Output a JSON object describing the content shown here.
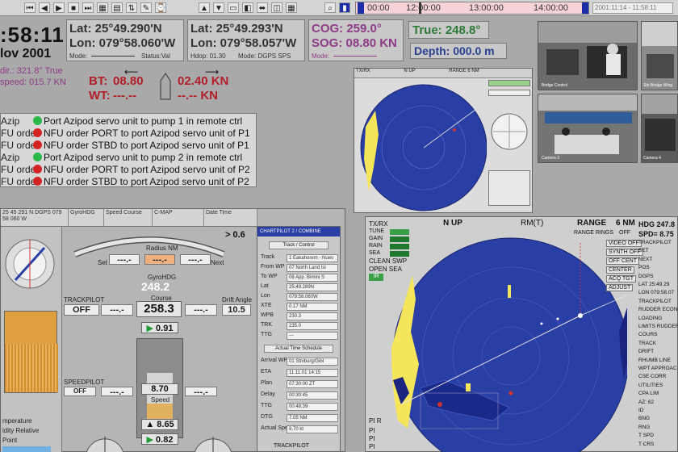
{
  "toolbar": {
    "buttons": [
      "⏮",
      "◀",
      "▶",
      "■",
      "⏭",
      "▦",
      "▤",
      "⇅",
      "✎",
      "⌚"
    ],
    "nav_buttons": [
      "▲",
      "▼",
      "▭",
      "◧",
      "⬌",
      "◫",
      "▦"
    ],
    "zoom_icon": "⌕",
    "times": [
      "00:00",
      "12:00:00",
      "13:00:00",
      "14:00:00"
    ],
    "stamp": "2001:11:14 - 11:58:11"
  },
  "clock": {
    "time": ":58:11",
    "date": "lov 2001"
  },
  "position_1": {
    "lat": "Lat:   25°49.290'N",
    "lon": "Lon: 079°58.060'W",
    "mode_label": "Mode:",
    "status_label": "Status:Val"
  },
  "position_2": {
    "lat": "Lat:   25°49.293'N",
    "lon": "Lon: 079°58.057'W",
    "hdop": "Hdop: 01.30",
    "mode": "Mode: DGPS SPS"
  },
  "cog": {
    "cog": "COG: 259.0°",
    "sog": "SOG: 08.80 KN",
    "mode_label": "Mode:"
  },
  "true_heading": "True:   248.8°",
  "depth": "Depth: 000.0 m",
  "speed_strip": {
    "dir": "dir.: 321.8° True",
    "speed": "speed: 015.7 KN"
  },
  "bt_wt": {
    "bt_label": "BT:",
    "bt_fwd": "08.80",
    "bt_aft": "02.40 KN",
    "wt_label": "WT:",
    "wt_fwd": "---.--",
    "wt_aft": "--.-- KN"
  },
  "alarms": [
    {
      "tag": "Azip",
      "color": "green",
      "text": "Port Azipod servo unit to pump 1 in remote ctrl"
    },
    {
      "tag": "FU orde",
      "color": "red",
      "text": "NFU order PORT to port Azipod servo unit of P1"
    },
    {
      "tag": "FU orde",
      "color": "red",
      "text": "NFU order STBD to port Azipod servo unit of P1"
    },
    {
      "tag": "Azip",
      "color": "green",
      "text": "Port Azipod servo unit to pump 2 in remote ctrl"
    },
    {
      "tag": "FU orde",
      "color": "red",
      "text": "NFU order PORT to port Azipod servo unit of P2"
    },
    {
      "tag": "FU orde",
      "color": "red",
      "text": "NFU order STBD to port Azipod servo unit of P2"
    }
  ],
  "left_panel": {
    "header_cells": [
      "25 45 291 N DGPS\n 079 58 060 W",
      "GyroHDG",
      "Speed\nCourse",
      "C-MAP",
      "Date\nTime",
      "CHARTPILOT 2 / COMBINE"
    ],
    "radius_label": "Radius NM",
    "gt": "> 0.6",
    "set_label": "Set",
    "next_label": "Next",
    "gyrohdg_label": "GyroHDG",
    "gyrohdg": "248.2",
    "course_label": "Course",
    "course": "258.3",
    "trackpilot_label": "TRACKPILOT",
    "trackpilot_value": "OFF",
    "drift_label": "Drift Angle",
    "drift": "10.5",
    "rot_value": "0.91",
    "speedpilot_label": "SPEEDPILOT",
    "speedpilot_value": "OFF",
    "speed_label": "Speed",
    "speed_set": "8.70",
    "speed_actual": "8.65",
    "speed_lower": "0.82",
    "dashes": "---.-",
    "left_labels": [
      "mperature",
      "idity Relative",
      "Point"
    ]
  },
  "chartpilot": {
    "title": "CHARTPILOT 2 / COMBINE",
    "mode": "Track / Control",
    "rows": [
      [
        "Track",
        "1 Eakahorem - Nuev"
      ],
      [
        "From WP",
        "07 North Land Isl"
      ],
      [
        "To WP",
        "08 App. Bimini S"
      ],
      [
        "Lat",
        "25:49.289N"
      ],
      [
        "Lon",
        "079:58.060W"
      ],
      [
        "XTE",
        "0.17 NM"
      ],
      [
        "WPB",
        "230.3"
      ],
      [
        "TRK",
        "235.0"
      ],
      [
        "TTG",
        "---"
      ]
    ],
    "schedule_title": "Actual Time Schedule",
    "schedule_rows": [
      [
        "Arrival WP",
        "01 Stniburg/Gibl"
      ],
      [
        "ETA",
        "11.11.01 14:15"
      ],
      [
        "Plan",
        "07:30:00 ZT"
      ],
      [
        "Delay",
        "00:30:45"
      ],
      [
        "TTG",
        "00:48:39"
      ],
      [
        "DTG",
        "7.05 NM"
      ],
      [
        "Actual Speed",
        "8.70 kt"
      ]
    ],
    "footer": "TRACKPILOT"
  },
  "radar_big": {
    "mode": "TX/RX",
    "orientation": "N UP",
    "rm": "RM(T)",
    "range_label": "RANGE",
    "range": "6 NM",
    "range_rings": "RANGE RINGS",
    "rings_value": "OFF",
    "controls": [
      "TUNE",
      "GAIN",
      "RAIN",
      "SEA"
    ],
    "clean_swp": "CLEAN SWP",
    "open_sea": "OPEN SEA",
    "ir": "IR",
    "buttons": [
      "VIDEO OFF",
      "SYNTH OFF",
      "OFF CENT",
      "CENTER",
      "ACQ TGT",
      "ADJUST"
    ],
    "hdg": "HDG 247.8",
    "spd": "SPD= 8.75",
    "side": [
      "TRACKPILOT",
      "SET",
      "NEXT",
      "POS",
      "DGPS",
      "LAT  25:49.29",
      "LON  079:58.07",
      "TRACKPILOT",
      "RUDDER ECONO",
      "LOADING",
      "LIMITS  RUDDER",
      "COURS",
      "TRACK",
      "DRIFT",
      "RHUMB LINE",
      "WPT APPROAC",
      "CSE CORR",
      "UTILITIES",
      "CPA LIM",
      "AZ: 62",
      "ID",
      "BNG",
      "RNG",
      "T SPD",
      "T CRS"
    ],
    "bottom_left": [
      "PI R",
      "PI",
      "PI",
      "PI"
    ]
  },
  "radar_small": {
    "labels": [
      "TX/RX",
      "N UP",
      "RANGE 6 NM"
    ]
  },
  "cameras": [
    "Bridge Control",
    "Stb Bridge Wing",
    "Camera 3",
    "Camera 4"
  ]
}
